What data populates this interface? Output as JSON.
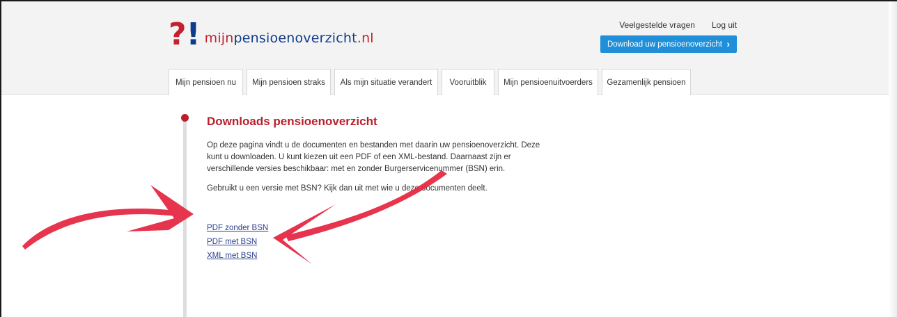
{
  "logo": {
    "mark_question": "?",
    "mark_exclaim": "!",
    "text_mijn": "mijn",
    "text_main": "pensioenoverzicht",
    "text_tld": ".nl"
  },
  "header": {
    "faq_link": "Veelgestelde vragen",
    "logout_link": "Log uit",
    "download_button": "Download uw pensioenoverzicht",
    "download_chevron_icon": "chevron-right-icon"
  },
  "tabs": [
    {
      "label": "Mijn pensioen nu"
    },
    {
      "label": "Mijn pensioen straks"
    },
    {
      "label": "Als mijn situatie verandert"
    },
    {
      "label": "Vooruitblik"
    },
    {
      "label": "Mijn pensioenuitvoerders"
    },
    {
      "label": "Gezamenlijk pensioen"
    }
  ],
  "main": {
    "title": "Downloads pensioenoverzicht",
    "intro": "Op deze pagina vindt u de documenten en bestanden met daarin uw pensioenoverzicht. Deze kunt u downloaden. U kunt kiezen uit een PDF of een XML-bestand. Daarnaast zijn er verschillende versies beschikbaar: met en zonder Burgerservicenummer (BSN) erin.",
    "warning": "Gebruikt u een versie met BSN? Kijk dan uit met wie u deze documenten deelt.",
    "links": [
      {
        "label": "PDF zonder BSN"
      },
      {
        "label": "PDF met BSN"
      },
      {
        "label": "XML met BSN"
      }
    ]
  },
  "colors": {
    "brand_red": "#b8202b",
    "brand_blue": "#0f3b8c",
    "button_blue": "#1e8fd8",
    "annotation_arrow": "#e62a45",
    "link_blue": "#2b3f8c"
  }
}
